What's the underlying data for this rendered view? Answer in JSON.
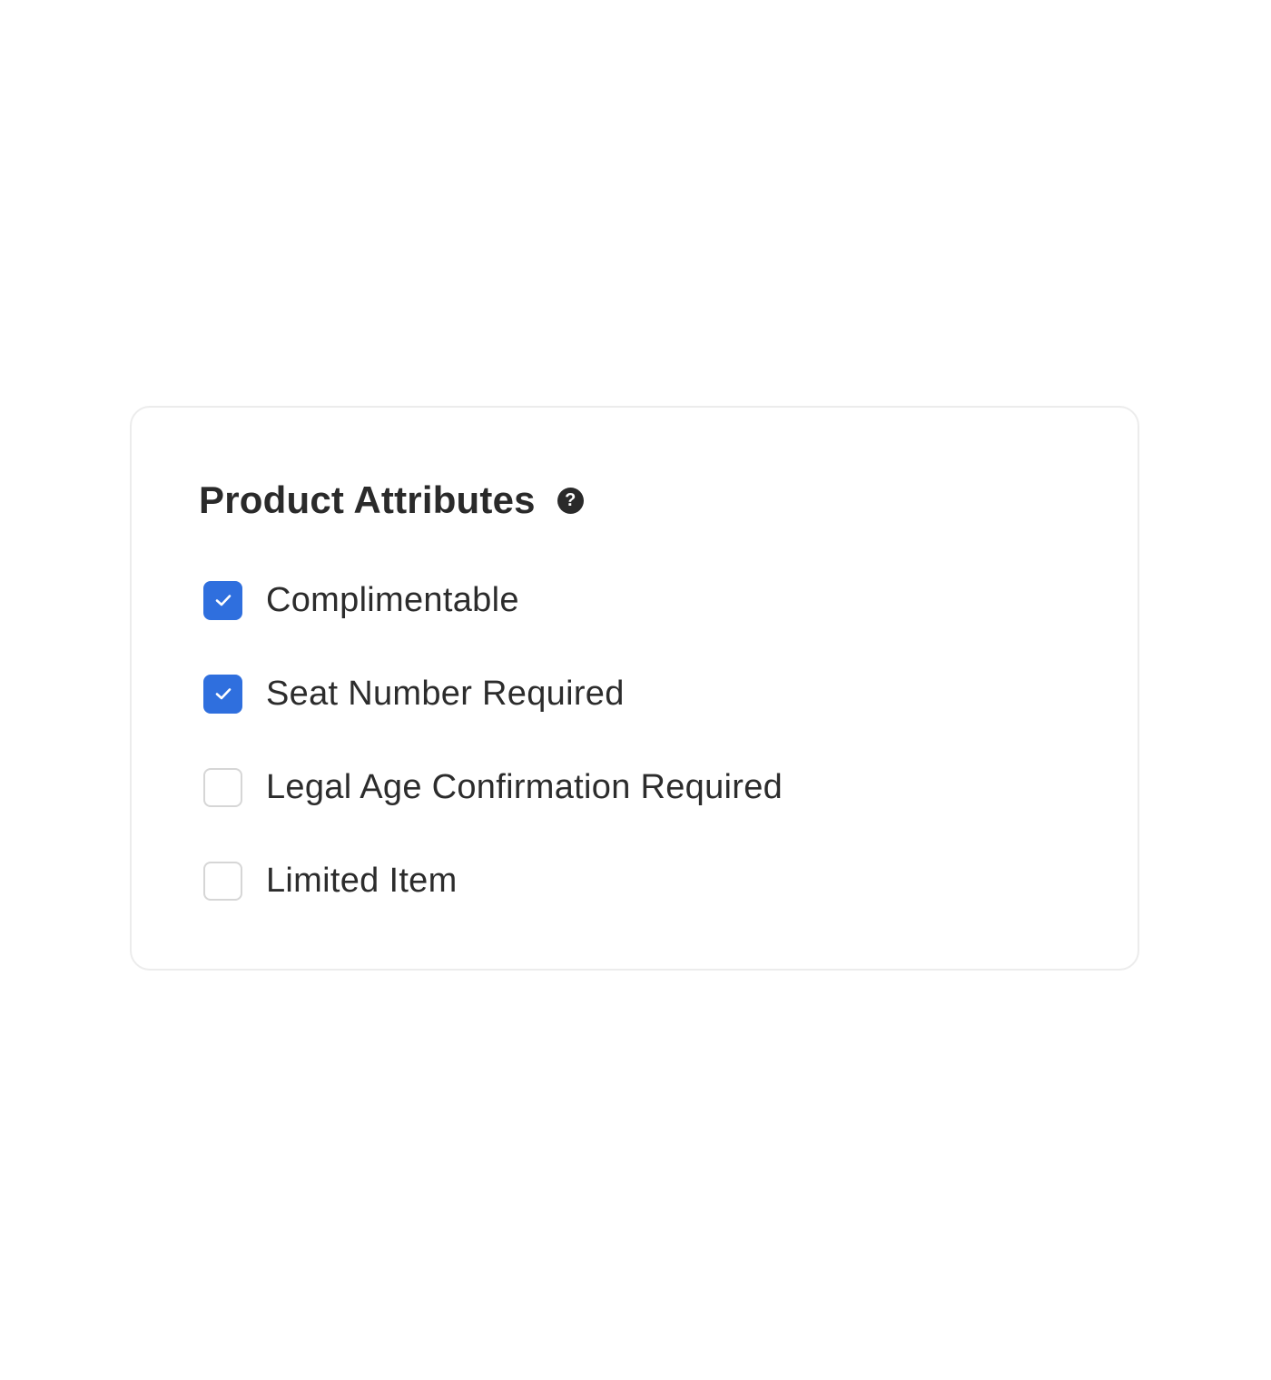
{
  "card": {
    "title": "Product Attributes",
    "help_icon": "question-circle-icon",
    "options": [
      {
        "label": "Complimentable",
        "checked": true
      },
      {
        "label": "Seat Number Required",
        "checked": true
      },
      {
        "label": "Legal Age Confirmation Required",
        "checked": false
      },
      {
        "label": "Limited Item",
        "checked": false
      }
    ]
  },
  "colors": {
    "accent": "#2f6fde",
    "text": "#2a2a2a",
    "border": "#ececec"
  }
}
